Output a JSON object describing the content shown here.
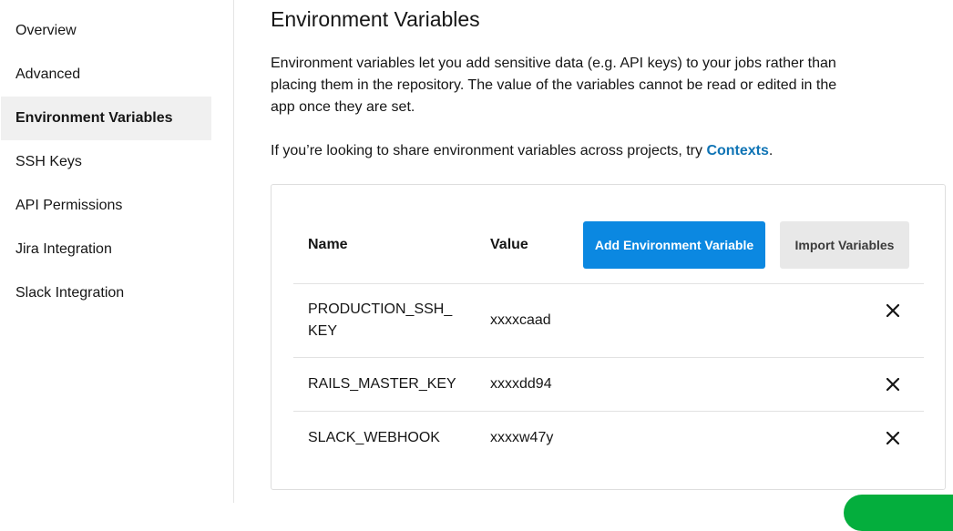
{
  "sidebar": {
    "items": [
      {
        "label": "Overview"
      },
      {
        "label": "Advanced"
      },
      {
        "label": "Environment Variables"
      },
      {
        "label": "SSH Keys"
      },
      {
        "label": "API Permissions"
      },
      {
        "label": "Jira Integration"
      },
      {
        "label": "Slack Integration"
      }
    ],
    "active": "Environment Variables"
  },
  "main": {
    "title": "Environment Variables",
    "description": "Environment variables let you add sensitive data (e.g. API keys) to your jobs rather than placing them in the repository. The value of the variables cannot be read or edited in the app once they are set.",
    "contexts_prefix": "If you’re looking to share environment variables across projects, try ",
    "contexts_link": "Contexts",
    "contexts_suffix": "."
  },
  "table": {
    "headers": {
      "name": "Name",
      "value": "Value"
    },
    "add_button": "Add Environment Variable",
    "import_button": "Import Variables",
    "rows": [
      {
        "name": "PRODUCTION_SSH_KEY",
        "value": "xxxxcaad"
      },
      {
        "name": "RAILS_MASTER_KEY",
        "value": "xxxxdd94"
      },
      {
        "name": "SLACK_WEBHOOK",
        "value": "xxxxw47y"
      }
    ],
    "delete_icon": "close-icon"
  },
  "colors": {
    "accent": "#0b88e1",
    "link": "#0f74b5",
    "active_bg": "#f0f0f0",
    "help_fab": "#04ae3d"
  }
}
